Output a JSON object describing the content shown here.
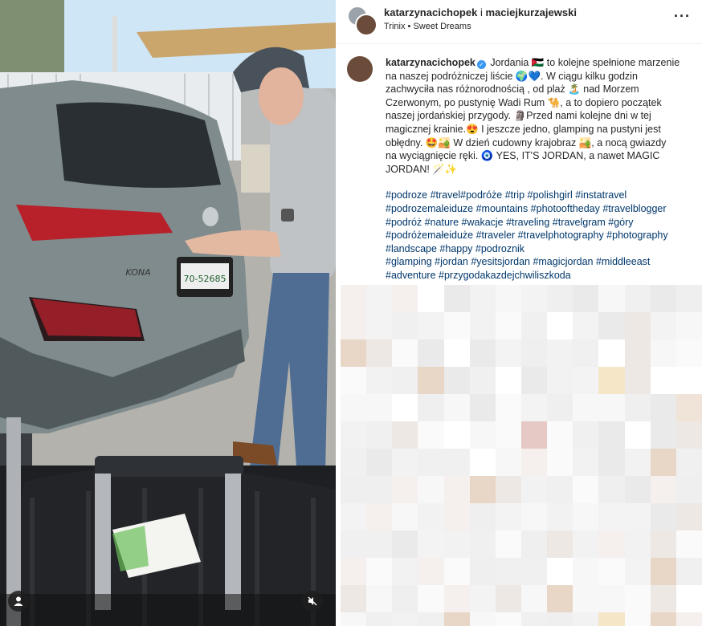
{
  "header": {
    "user1": "katarzynacichopek",
    "separator": "i",
    "user2": "maciejkurzajewski",
    "audio": "Trinix • Sweet Dreams",
    "more_icon": "ellipsis-icon"
  },
  "caption": {
    "username": "katarzynacichopek",
    "lines": [
      "Jordania 🇯🇴 to kolejne spełnione marzenie",
      "na naszej podróżniczej liście 🌍💙. W ciągu kilku godzin",
      "zachwyciła nas różnorodnością , od plaż 🏝️ nad Morzem",
      "Czerwonym, po pustynię Wadi Rum 🐪, a to dopiero początek",
      "naszej jordańskiej przygody. 🗿Przed nami kolejne dni w tej",
      "magicznej krainie.😍 I jeszcze jedno, glamping na pustyni jest",
      "obłędny. 🤩🏜️ W dzień cudowny krajobraz 🏜️, a nocą gwiazdy",
      "na wyciągnięcie ręki. 🧿 YES, IT'S JORDAN, a nawet MAGIC",
      "JORDAN! 🪄✨"
    ],
    "hashtags": [
      "#podroze #travel#podróże #trip #polishgirl #instatravel",
      "#podrozemaleiduze #mountains #photooftheday #travelblogger",
      "#podróż #nature #wakacje #traveling #travelgram #góry",
      "#podróżemałeiduże #traveler #travelphotography #photography",
      "#landscape #happy #podroznik",
      "#glamping #jordan #yesitsjordan #magicjordan #middleeast",
      "#adventure #przygodakazdejchwiliszkoda"
    ]
  },
  "media": {
    "car_badge": "KONA",
    "plate": "70-52685",
    "user_icon": "user-icon",
    "mute_icon": "muted-speaker-icon"
  },
  "colors": {
    "accent_link": "#00376b",
    "verified": "#3897f0",
    "car_body": "#7f8b8d"
  }
}
